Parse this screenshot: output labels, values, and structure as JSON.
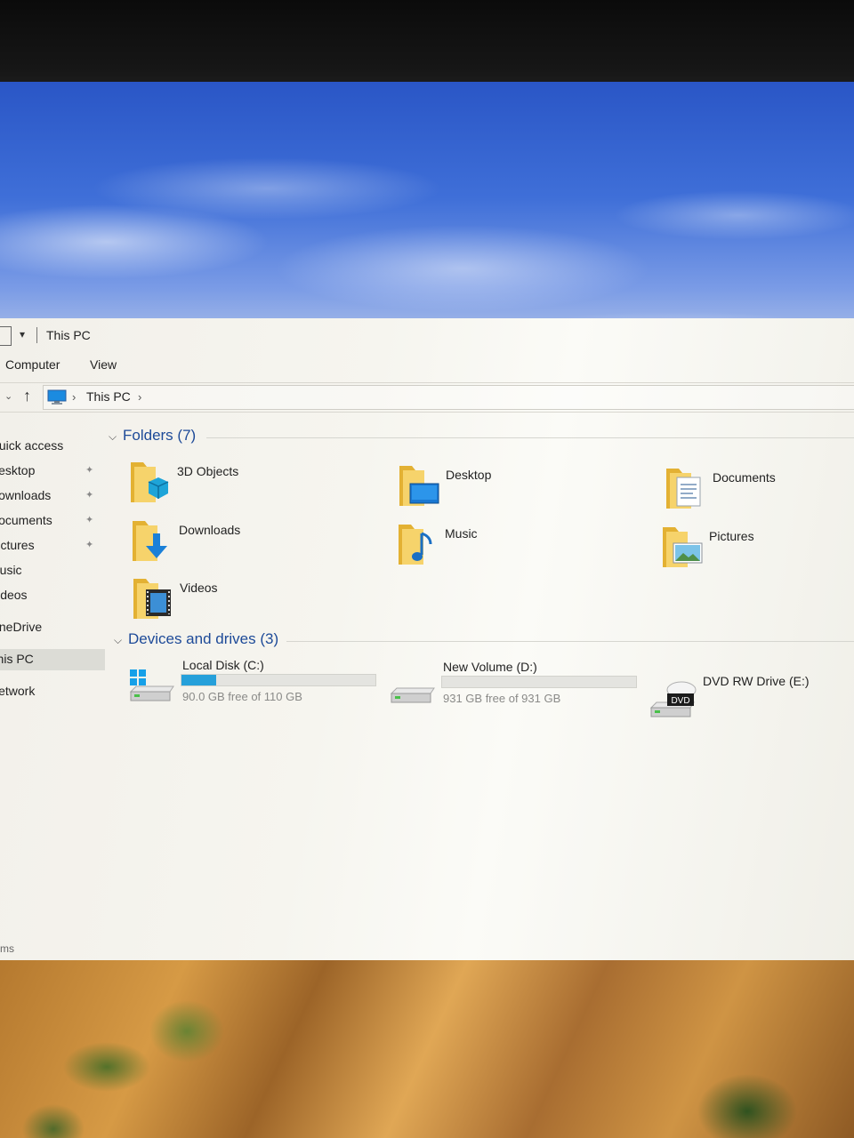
{
  "window": {
    "title": "This PC"
  },
  "ribbon": {
    "tabs": [
      "Computer",
      "View"
    ]
  },
  "address": {
    "crumb": "This PC"
  },
  "nav": {
    "items": [
      {
        "label": "Quick access",
        "pinned": false
      },
      {
        "label": "Desktop",
        "pinned": true
      },
      {
        "label": "Downloads",
        "pinned": true
      },
      {
        "label": "Documents",
        "pinned": true
      },
      {
        "label": "Pictures",
        "pinned": true
      },
      {
        "label": "Music",
        "pinned": false
      },
      {
        "label": "Videos",
        "pinned": false
      },
      {
        "label": "OneDrive",
        "pinned": false
      },
      {
        "label": "This PC",
        "pinned": false,
        "selected": true
      },
      {
        "label": "Network",
        "pinned": false
      }
    ]
  },
  "folders_group": {
    "heading": "Folders (7)",
    "items": [
      {
        "name": "3D Objects",
        "icon": "3d-objects-folder-icon"
      },
      {
        "name": "Desktop",
        "icon": "desktop-folder-icon"
      },
      {
        "name": "Documents",
        "icon": "documents-folder-icon"
      },
      {
        "name": "Downloads",
        "icon": "downloads-folder-icon"
      },
      {
        "name": "Music",
        "icon": "music-folder-icon"
      },
      {
        "name": "Pictures",
        "icon": "pictures-folder-icon"
      },
      {
        "name": "Videos",
        "icon": "videos-folder-icon"
      }
    ]
  },
  "drives_group": {
    "heading": "Devices and drives (3)",
    "items": [
      {
        "name": "Local Disk (C:)",
        "free_text": "90.0 GB free of 110 GB",
        "used_fraction": 0.18,
        "icon": "windows-drive-icon"
      },
      {
        "name": "New Volume (D:)",
        "free_text": "931 GB free of 931 GB",
        "used_fraction": 0.0,
        "icon": "hard-drive-icon"
      },
      {
        "name": "DVD RW Drive (E:)",
        "icon": "dvd-drive-icon",
        "badge": "DVD"
      }
    ]
  },
  "status": {
    "text": "ms"
  },
  "colors": {
    "accent": "#26a0da",
    "group_heading": "#1d4a98",
    "folder": "#f2c74e"
  }
}
